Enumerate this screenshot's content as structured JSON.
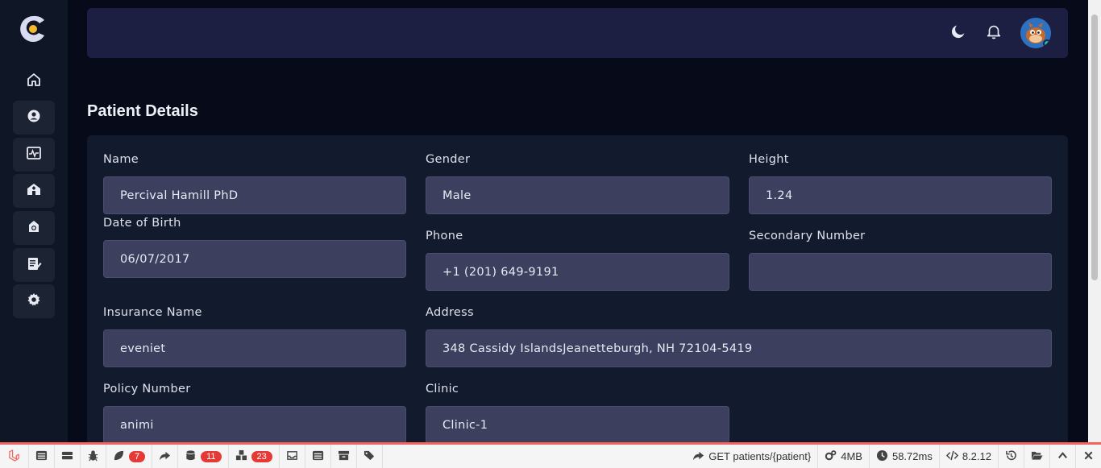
{
  "header": {
    "dark_mode_icon": "moon-icon",
    "notifications_icon": "bell-icon",
    "avatar_alt": "User avatar"
  },
  "sidebar": {
    "items": [
      {
        "name": "home",
        "icon": "home-icon"
      },
      {
        "name": "patients",
        "icon": "user-circle-icon"
      },
      {
        "name": "monitor",
        "icon": "activity-icon"
      },
      {
        "name": "clinics",
        "icon": "hospital-icon"
      },
      {
        "name": "medical",
        "icon": "medical-bag-icon"
      },
      {
        "name": "records",
        "icon": "clipboard-edit-icon"
      },
      {
        "name": "settings",
        "icon": "gear-icon"
      }
    ]
  },
  "page": {
    "title": "Patient Details"
  },
  "patient": {
    "name_label": "Name",
    "name": "Percival Hamill PhD",
    "gender_label": "Gender",
    "gender": "Male",
    "height_label": "Height",
    "height": "1.24",
    "dob_label": "Date of Birth",
    "dob": "06/07/2017",
    "phone_label": "Phone",
    "phone": "+1 (201) 649-9191",
    "secondary_label": "Secondary Number",
    "secondary": "",
    "insurance_label": "Insurance Name",
    "insurance": "eveniet",
    "address_label": "Address",
    "address": "348 Cassidy IslandsJeanetteburgh, NH 72104-5419",
    "policy_label": "Policy Number",
    "policy": "animi",
    "clinic_label": "Clinic",
    "clinic": "Clinic-1"
  },
  "debugbar": {
    "badges": {
      "timeline": "7",
      "queries": "11",
      "models": "23"
    },
    "route": "GET patients/{patient}",
    "memory": "4MB",
    "time": "58.72ms",
    "php_version": "8.2.12"
  },
  "colors": {
    "accent": "#f5b82e",
    "header_bg": "#1d1f42",
    "field_bg": "#3c3f5e",
    "debug_accent": "#f4645f"
  }
}
